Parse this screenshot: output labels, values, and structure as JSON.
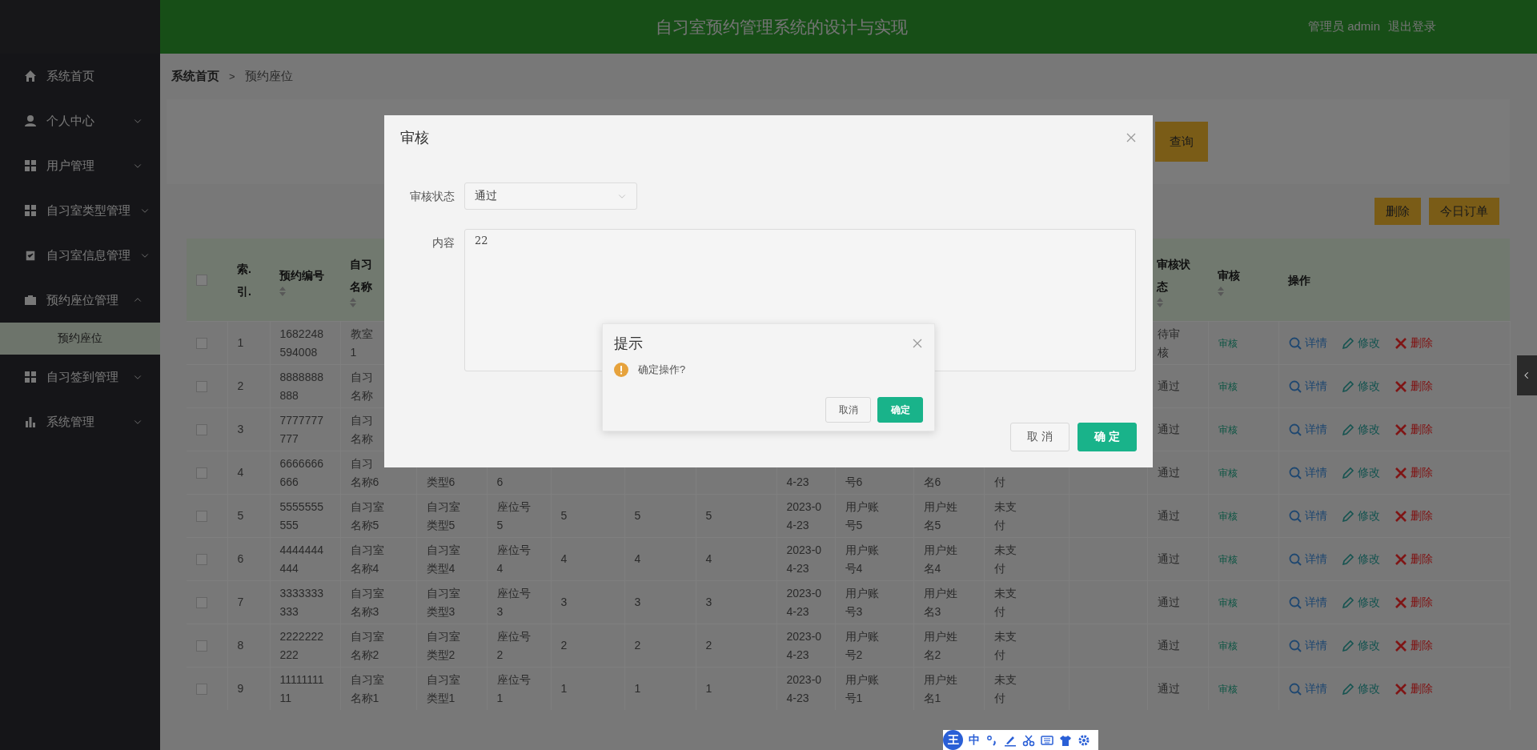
{
  "header": {
    "title": "自习室预约管理系统的设计与实现",
    "user": "管理员 admin",
    "logout": "退出登录"
  },
  "sidebar": {
    "items": [
      {
        "label": "系统首页"
      },
      {
        "label": "个人中心",
        "expanded": false
      },
      {
        "label": "用户管理",
        "expanded": false
      },
      {
        "label": "自习室类型管理",
        "expanded": false
      },
      {
        "label": "自习室信息管理",
        "expanded": false
      },
      {
        "label": "预约座位管理",
        "expanded": true,
        "children": [
          {
            "label": "预约座位",
            "selected": true
          }
        ]
      },
      {
        "label": "自习签到管理",
        "expanded": false
      },
      {
        "label": "系统管理",
        "expanded": false
      }
    ]
  },
  "breadcrumb": {
    "items": [
      "系统首页",
      "预约座位"
    ],
    "separator": ">"
  },
  "search": {
    "button": "查询"
  },
  "toolbar": [
    {
      "label": "删除"
    },
    {
      "label": "今日订单"
    }
  ],
  "table": {
    "all_checked": false,
    "header": {
      "index": {
        "label": "索.引.",
        "sortable": false
      },
      "booking_no": {
        "label": "预约编号",
        "sortable": true
      },
      "room_name": {
        "label": "自习名称",
        "sortable": true
      },
      "status": {
        "label": "审核状态",
        "sortable": true
      },
      "audit": {
        "label": "审核",
        "sortable": true
      },
      "actions": {
        "label": "操作",
        "sortable": false
      }
    },
    "rows": [
      {
        "checked": false,
        "index": "1",
        "booking_no": "1682248594008",
        "room_name": "教室1",
        "status": "待审核",
        "audit": "审核",
        "actions": [
          {
            "label": "详情",
            "kind": "view"
          },
          {
            "label": "修改",
            "kind": "edit"
          },
          {
            "label": "删除",
            "kind": "delete"
          }
        ]
      },
      {
        "checked": false,
        "index": "2",
        "booking_no": "8888888888",
        "room_name": "自习名称",
        "status": "通过",
        "audit": "审核",
        "actions": [
          {
            "label": "详情",
            "kind": "view"
          },
          {
            "label": "修改",
            "kind": "edit"
          },
          {
            "label": "删除",
            "kind": "delete"
          }
        ]
      },
      {
        "checked": false,
        "index": "3",
        "booking_no": "7777777777",
        "room_name": "自习名称",
        "status": "通过",
        "audit": "审核",
        "actions": [
          {
            "label": "详情",
            "kind": "view"
          },
          {
            "label": "修改",
            "kind": "edit"
          },
          {
            "label": "删除",
            "kind": "delete"
          }
        ]
      },
      {
        "checked": false,
        "index": "4",
        "booking_no": "6666666666",
        "room_name": "自习名称6",
        "column_5": "\n类型6",
        "column_6": "\n6",
        "column_10": "\n4-23",
        "column_11": "\n号6",
        "column_12": "\n名6",
        "column_13": "\n付",
        "status": "通过",
        "audit": "审核",
        "actions": [
          {
            "label": "详情",
            "kind": "view"
          },
          {
            "label": "修改",
            "kind": "edit"
          },
          {
            "label": "删除",
            "kind": "delete"
          }
        ]
      },
      {
        "checked": false,
        "index": "5",
        "booking_no": "5555555555",
        "room_name": "自习室名称5",
        "column_5": "自习室类型5",
        "column_6": "座位号5",
        "column_7": "5",
        "column_8": "5",
        "column_9": "5",
        "column_10": "2023-04-23",
        "column_11": "用户账号5",
        "column_12": "用户姓名5",
        "column_13": "未支付",
        "status": "通过",
        "audit": "审核",
        "actions": [
          {
            "label": "详情",
            "kind": "view"
          },
          {
            "label": "修改",
            "kind": "edit"
          },
          {
            "label": "删除",
            "kind": "delete"
          }
        ]
      },
      {
        "checked": false,
        "index": "6",
        "booking_no": "4444444444",
        "room_name": "自习室名称4",
        "column_5": "自习室类型4",
        "column_6": "座位号4",
        "column_7": "4",
        "column_8": "4",
        "column_9": "4",
        "column_10": "2023-04-23",
        "column_11": "用户账号4",
        "column_12": "用户姓名4",
        "column_13": "未支付",
        "status": "通过",
        "audit": "审核",
        "actions": [
          {
            "label": "详情",
            "kind": "view"
          },
          {
            "label": "修改",
            "kind": "edit"
          },
          {
            "label": "删除",
            "kind": "delete"
          }
        ]
      },
      {
        "checked": false,
        "index": "7",
        "booking_no": "3333333333",
        "room_name": "自习室名称3",
        "column_5": "自习室类型3",
        "column_6": "座位号3",
        "column_7": "3",
        "column_8": "3",
        "column_9": "3",
        "column_10": "2023-04-23",
        "column_11": "用户账号3",
        "column_12": "用户姓名3",
        "column_13": "未支付",
        "status": "通过",
        "audit": "审核",
        "actions": [
          {
            "label": "详情",
            "kind": "view"
          },
          {
            "label": "修改",
            "kind": "edit"
          },
          {
            "label": "删除",
            "kind": "delete"
          }
        ]
      },
      {
        "checked": false,
        "index": "8",
        "booking_no": "2222222222",
        "room_name": "自习室名称2",
        "column_5": "自习室类型2",
        "column_6": "座位号2",
        "column_7": "2",
        "column_8": "2",
        "column_9": "2",
        "column_10": "2023-04-23",
        "column_11": "用户账号2",
        "column_12": "用户姓名2",
        "column_13": "未支付",
        "status": "通过",
        "audit": "审核",
        "actions": [
          {
            "label": "详情",
            "kind": "view"
          },
          {
            "label": "修改",
            "kind": "edit"
          },
          {
            "label": "删除",
            "kind": "delete"
          }
        ]
      },
      {
        "checked": false,
        "index": "9",
        "booking_no": "1111111111",
        "room_name": "自习室名称1",
        "column_5": "自习室类型1",
        "column_6": "座位号1",
        "column_7": "1",
        "column_8": "1",
        "column_9": "1",
        "column_10": "2023-04-23",
        "column_11": "用户账号1",
        "column_12": "用户姓名1",
        "column_13": "未支付",
        "status": "通过",
        "audit": "审核",
        "actions": [
          {
            "label": "详情",
            "kind": "view"
          },
          {
            "label": "修改",
            "kind": "edit"
          },
          {
            "label": "删除",
            "kind": "delete"
          }
        ]
      }
    ]
  },
  "dialog": {
    "title": "审核",
    "fields": [
      {
        "label": "审核状态",
        "kind": "select",
        "value": "通过"
      },
      {
        "label": "内容",
        "kind": "textarea",
        "value": "22"
      }
    ],
    "buttons": [
      {
        "label": "取 消",
        "kind": "default"
      },
      {
        "label": "确 定",
        "kind": "primary"
      }
    ]
  },
  "message_box": {
    "title": "提示",
    "message": "确定操作?",
    "buttons": [
      {
        "label": "取消",
        "kind": "default"
      },
      {
        "label": "确定",
        "kind": "primary"
      }
    ]
  },
  "ime_toolbar": {
    "logo": "王",
    "mode": "中"
  }
}
